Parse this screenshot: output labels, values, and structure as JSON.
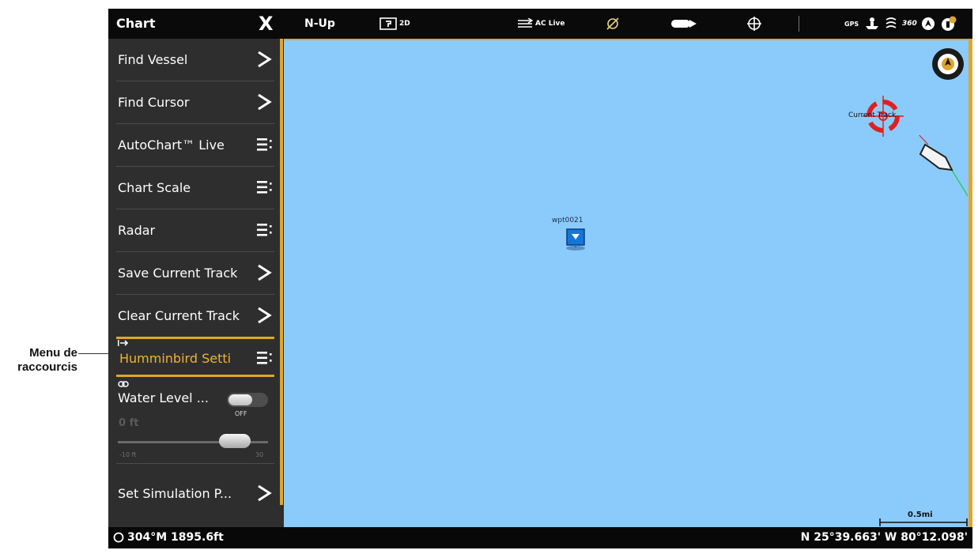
{
  "callout": {
    "line1": "Menu de",
    "line2": "raccourcis"
  },
  "topbar": {
    "title": "Chart",
    "close_glyph": "X",
    "orientation": "N-Up",
    "view_mode": "2D",
    "autochart_label": "AC Live",
    "gps_label": "GPS",
    "view360_label": "360"
  },
  "menu": {
    "items": [
      {
        "label": "Find Vessel",
        "icon": "chevron-right-icon"
      },
      {
        "label": "Find Cursor",
        "icon": "chevron-right-icon"
      },
      {
        "label": "AutoChart™ Live",
        "icon": "submenu-icon"
      },
      {
        "label": "Chart Scale",
        "icon": "submenu-icon"
      },
      {
        "label": "Radar",
        "icon": "submenu-icon"
      },
      {
        "label": "Save Current Track",
        "icon": "chevron-right-icon"
      },
      {
        "label": "Clear Current Track",
        "icon": "chevron-right-icon"
      },
      {
        "label": "Humminbird Setti",
        "icon": "submenu-icon"
      }
    ],
    "water_level": {
      "label": "Water Level ...",
      "toggle_state": "OFF",
      "value": "0 ft",
      "slider_min": "-10 ft",
      "slider_max": "30"
    },
    "simulation": {
      "label": "Set Simulation P...",
      "icon": "chevron-right-icon"
    }
  },
  "map": {
    "waypoint_label": "wpt0021",
    "track_label": "Current Track",
    "scale_label": "0.5mi",
    "colors": {
      "water": "#8bcbfb",
      "accent": "#e0a52a",
      "cursor": "#e02020"
    }
  },
  "bottombar": {
    "heading_depth": "304°M  1895.6ft",
    "coordinates": "N 25°39.663' W 80°12.098'"
  }
}
